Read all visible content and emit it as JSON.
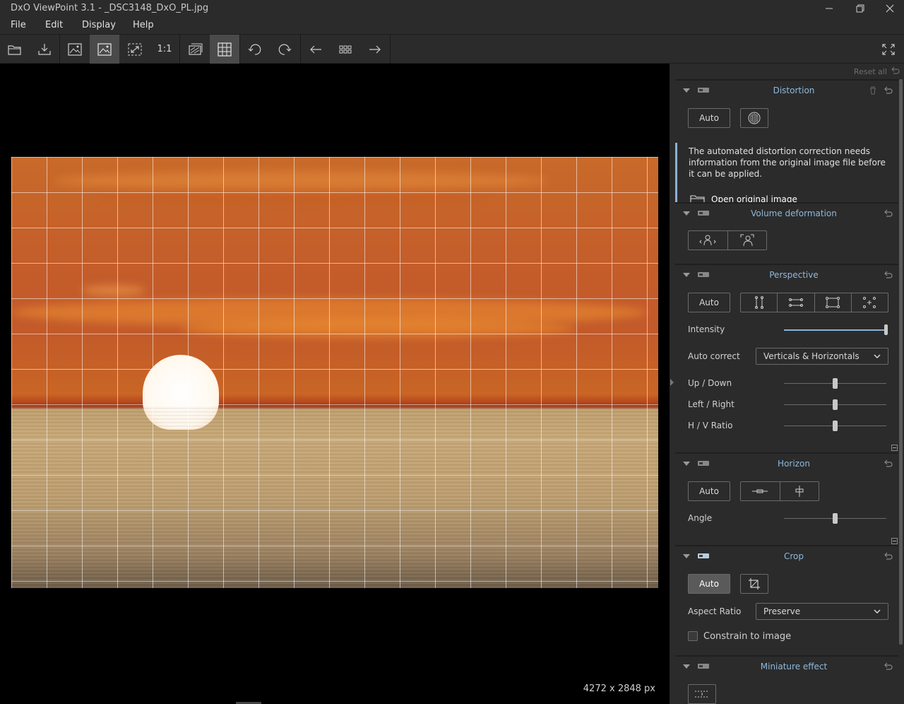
{
  "window": {
    "title": "DxO ViewPoint 3.1 - _DSC3148_DxO_PL.jpg"
  },
  "menu": {
    "file": "File",
    "edit": "Edit",
    "display": "Display",
    "help": "Help"
  },
  "toolbar": {
    "one_to_one": "1:1"
  },
  "viewer": {
    "dimensions": "4272 x 2848 px"
  },
  "panel": {
    "reset_all": "Reset all",
    "distortion": {
      "title": "Distortion",
      "auto_label": "Auto",
      "info_text": "The automated distortion correction needs information from the original image file before it can be applied.",
      "open_link": "Open original image"
    },
    "volume": {
      "title": "Volume deformation"
    },
    "perspective": {
      "title": "Perspective",
      "auto_label": "Auto",
      "intensity_label": "Intensity",
      "intensity_value": 1.0,
      "autocorrect_label": "Auto correct",
      "autocorrect_value": "Verticals & Horizontals",
      "updown_label": "Up / Down",
      "updown_value": 0.5,
      "leftright_label": "Left / Right",
      "leftright_value": 0.5,
      "hvratio_label": "H / V Ratio",
      "hvratio_value": 0.5
    },
    "horizon": {
      "title": "Horizon",
      "auto_label": "Auto",
      "angle_label": "Angle",
      "angle_value": 0.5
    },
    "crop": {
      "title": "Crop",
      "auto_label": "Auto",
      "aspect_label": "Aspect Ratio",
      "aspect_value": "Preserve",
      "constrain_label": "Constrain to image"
    },
    "miniature": {
      "title": "Miniature effect"
    }
  },
  "colors": {
    "accent": "#8fb8dc",
    "panel_bg": "#2b2b2b"
  }
}
